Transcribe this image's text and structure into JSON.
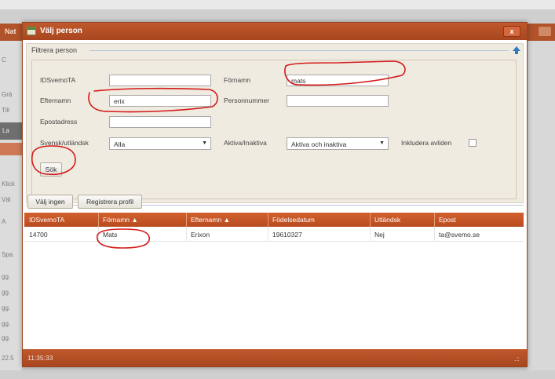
{
  "background": {
    "title_fragment": "Nat",
    "left_fragments": [
      "C",
      "Grä",
      "Till",
      "La",
      "Klick",
      "Väl",
      "A",
      "Spa",
      "gg.",
      "gg.",
      "gg.",
      "gg.",
      "gg.",
      "22.5"
    ]
  },
  "dialog": {
    "title": "Välj person",
    "close_label": "x"
  },
  "filter": {
    "legend": "Filtrera person",
    "fields": {
      "idsvemota_label": "IDSvemoTA",
      "idsvemota_value": "",
      "fornamn_label": "Förnamn",
      "fornamn_value": "mats",
      "efternamn_label": "Efternamn",
      "efternamn_value": "erix",
      "personnummer_label": "Personnummer",
      "personnummer_value": "",
      "epost_label": "Epostadress",
      "epost_value": "",
      "svensk_label": "Svensk/utländsk",
      "svensk_value": "Alla",
      "aktiva_label": "Aktiva/Inaktiva",
      "aktiva_value": "Aktiva och inaktiva",
      "avliden_label": "Inkludera avliden"
    },
    "search_button": "Sök"
  },
  "toolbar": {
    "none_button": "Välj ingen",
    "register_button": "Registrera profil"
  },
  "table": {
    "columns": [
      "IDSvemoTA",
      "Förnamn ▲",
      "Efternamn ▲",
      "Födelsedatum",
      "Utländsk",
      "Epost"
    ],
    "rows": [
      [
        "14700",
        "Mats",
        "Erixon",
        "19610327",
        "Nej",
        "ta@svemo.se"
      ]
    ]
  },
  "status": {
    "time": "11:35:33",
    "grip": ".::"
  },
  "colors": {
    "accent": "#b84c20",
    "annotation": "#d41a1a"
  }
}
